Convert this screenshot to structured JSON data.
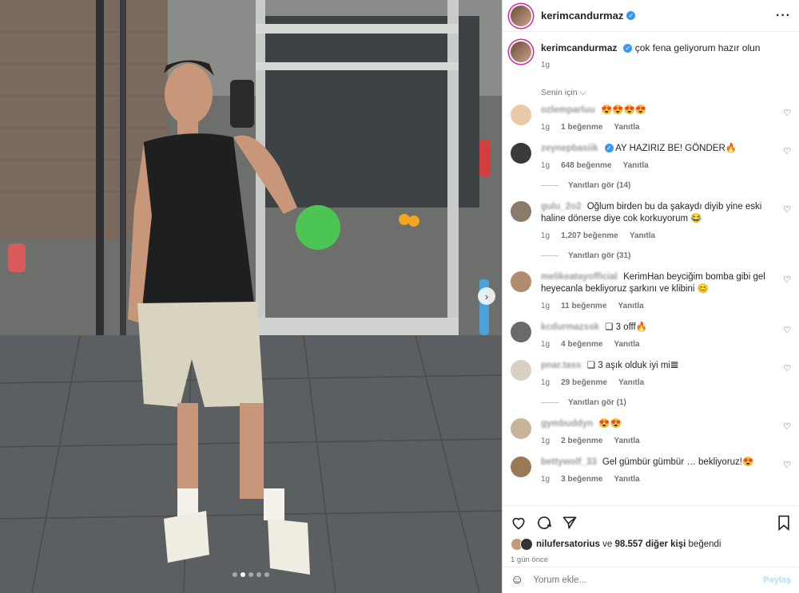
{
  "post": {
    "username": "kerimcandurmaz",
    "caption": "çok fena geliyorum hazır olun",
    "caption_time": "1g"
  },
  "section_label": "Senin için",
  "comments": [
    {
      "user": "ozlemparluu",
      "text": "😍😍😍😍",
      "time": "1g",
      "likes": "1 beğenme",
      "reply": "Yanıtla",
      "verified": false,
      "avatar_color": "#e8c9a8"
    },
    {
      "user": "zeynepbasiik",
      "text": "AY HAZIRIZ BE! GÖNDER🔥",
      "time": "1g",
      "likes": "648 beğenme",
      "reply": "Yanıtla",
      "verified": true,
      "avatar_color": "#3a3a3a",
      "replies": "Yanıtları gör (14)"
    },
    {
      "user": "gulu_2o2",
      "text": "Oğlum birden bu da şakaydı diyib yine eski haline dönerse diye cok korkuyorum 😂",
      "time": "1g",
      "likes": "1,207 beğenme",
      "reply": "Yanıtla",
      "verified": false,
      "avatar_color": "#8a7a6a",
      "replies": "Yanıtları gör (31)"
    },
    {
      "user": "melikeatayofficial",
      "text": "KerimHan beyciğim bomba gibi gel heyecanla bekliyoruz şarkını ve klibini 😊",
      "time": "1g",
      "likes": "11 beğenme",
      "reply": "Yanıtla",
      "verified": false,
      "avatar_color": "#b28a6e"
    },
    {
      "user": "kcdurmazssk",
      "text": "❏ 3 offf🔥",
      "time": "1g",
      "likes": "4 beğenme",
      "reply": "Yanıtla",
      "verified": false,
      "avatar_color": "#6a6a6a"
    },
    {
      "user": "pnar.tass",
      "text": "❏ 3 aşık olduk iyi mi𝌆",
      "time": "1g",
      "likes": "29 beğenme",
      "reply": "Yanıtla",
      "verified": false,
      "avatar_color": "#d9d0c4",
      "replies": "Yanıtları gör (1)"
    },
    {
      "user": "gymbuddyn",
      "text": "😍😍",
      "time": "1g",
      "likes": "2 beğenme",
      "reply": "Yanıtla",
      "verified": false,
      "avatar_color": "#c9b49a"
    },
    {
      "user": "bettywolf_33",
      "text": "Gel gümbür gümbür … bekliyoruz!😍",
      "time": "1g",
      "likes": "3 beğenme",
      "reply": "Yanıtla",
      "verified": false,
      "avatar_color": "#9a7a55"
    }
  ],
  "likes_line": {
    "user": "nilufersatorius",
    "connector": "ve",
    "others": "98.557 diğer kişi",
    "suffix": "beğendi"
  },
  "posted_ago": "1 gün önce",
  "add_comment": {
    "placeholder": "Yorum ekle...",
    "post_label": "Paylaş"
  },
  "icons": {
    "more": "more-icon",
    "heart": "heart-icon",
    "comment": "comment-icon",
    "share": "share-icon",
    "save": "bookmark-icon",
    "emoji": "emoji-icon",
    "next": "chevron-right-icon"
  },
  "carousel": {
    "count": 5,
    "active": 1
  },
  "colors": {
    "verified": "#3897f0",
    "accent_ring": "#d6249f",
    "post_disabled": "#b2dffc"
  }
}
